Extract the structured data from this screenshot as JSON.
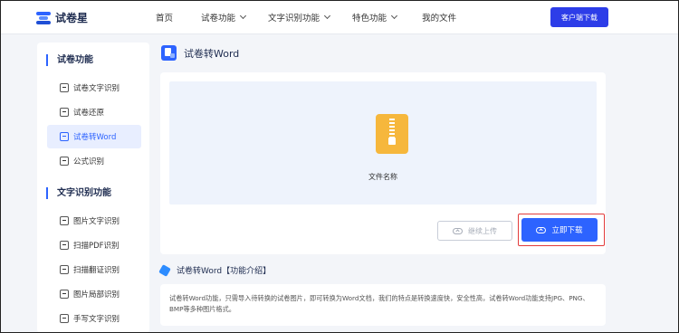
{
  "app": {
    "logo_text": "试卷星"
  },
  "nav": {
    "items": [
      {
        "label": "首页",
        "has_dropdown": false
      },
      {
        "label": "试卷功能",
        "has_dropdown": true
      },
      {
        "label": "文字识别功能",
        "has_dropdown": true
      },
      {
        "label": "特色功能",
        "has_dropdown": true
      },
      {
        "label": "我的文件",
        "has_dropdown": false
      }
    ],
    "download_label": "客户端下载"
  },
  "sidebar": {
    "sections": [
      {
        "title": "试卷功能",
        "items": [
          {
            "label": "试卷文字识别",
            "active": false
          },
          {
            "label": "试卷还原",
            "active": false
          },
          {
            "label": "试卷转Word",
            "active": true
          },
          {
            "label": "公式识别",
            "active": false
          }
        ]
      },
      {
        "title": "文字识别功能",
        "items": [
          {
            "label": "图片文字识别",
            "active": false
          },
          {
            "label": "扫描PDF识别",
            "active": false
          },
          {
            "label": "扫描翻证识别",
            "active": false
          },
          {
            "label": "图片局部识别",
            "active": false
          },
          {
            "label": "手写文字识别",
            "active": false
          }
        ]
      }
    ]
  },
  "main": {
    "title": "试卷转Word",
    "file_name": "文件名称",
    "continue_upload_label": "继续上传",
    "download_now_label": "立即下载"
  },
  "intro": {
    "title": "试卷转Word【功能介绍】",
    "text": "试卷转Word功能，只需导入待转换的试卷图片，即可转换为Word文档，我们的特点是转换速度快，安全性高，试卷转Word功能支持JPG、PNG、BMP等多种图片格式。"
  },
  "colors": {
    "primary": "#2d63ff",
    "nav_button": "#2d3de8",
    "highlight_border": "#e23b3b",
    "file_icon": "#f6b73c"
  }
}
